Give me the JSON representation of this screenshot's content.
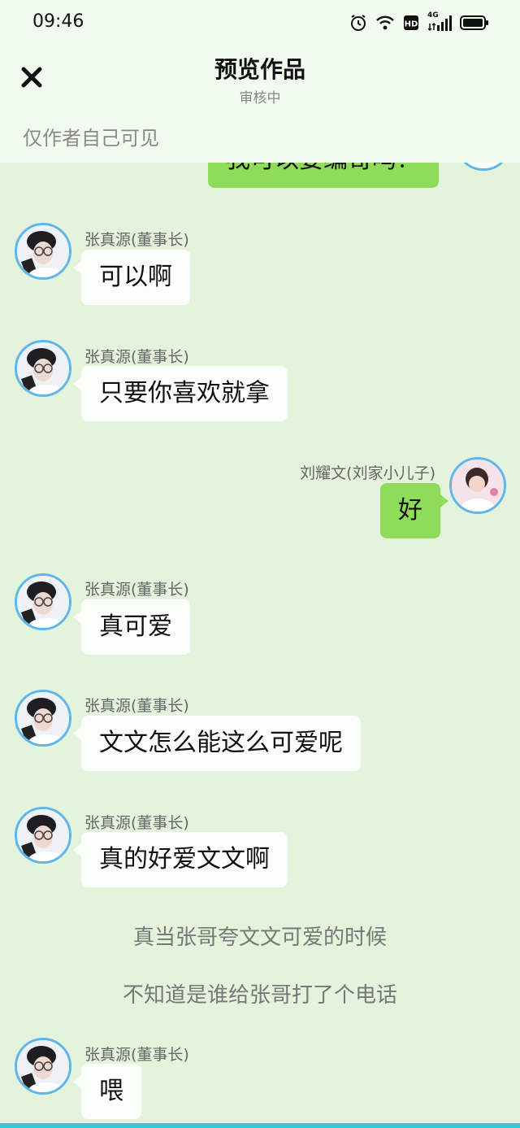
{
  "status_bar": {
    "time": "09:46",
    "network": "4G"
  },
  "header": {
    "title": "预览作品",
    "subtitle": "审核中",
    "notice": "仅作者自己可见"
  },
  "messages": [
    {
      "side": "out",
      "text": "我可以要编哥吗？"
    },
    {
      "side": "in",
      "name": "张真源(董事长)",
      "text": "可以啊"
    },
    {
      "side": "in",
      "name": "张真源(董事长)",
      "text": "只要你喜欢就拿"
    },
    {
      "side": "out",
      "name": "刘耀文(刘家小儿子)",
      "text": "好"
    },
    {
      "side": "in",
      "name": "张真源(董事长)",
      "text": "真可爱"
    },
    {
      "side": "in",
      "name": "张真源(董事长)",
      "text": "文文怎么能这么可爱呢"
    },
    {
      "side": "in",
      "name": "张真源(董事长)",
      "text": "真的好爱文文啊"
    },
    {
      "side": "in",
      "name": "张真源(董事长)",
      "text": "喂"
    }
  ],
  "narration": [
    "真当张哥夸文文可爱的时候",
    "不知道是谁给张哥打了个电话"
  ],
  "colors": {
    "background": "#e4f3dc",
    "out_bubble": "#8fdc5b",
    "in_bubble": "#fbfdfa",
    "avatar_ring": "#5fb6e8"
  }
}
